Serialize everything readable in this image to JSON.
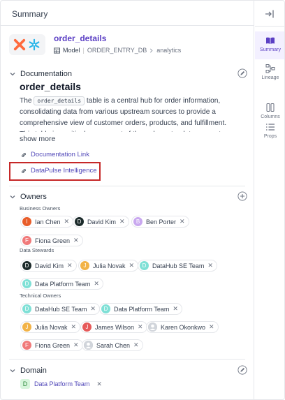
{
  "header": {
    "title": "Summary"
  },
  "entity": {
    "name": "order_details",
    "type": "Model",
    "db": "ORDER_ENTRY_DB",
    "schema": "analytics"
  },
  "documentation": {
    "section_title": "Documentation",
    "title": "order_details",
    "body_pre": "The ",
    "body_code": "order_details",
    "body_post": " table is a central hub for order information, consolidating data from various upstream sources to provide a comprehensive view of customer orders, products, and fulfillment. This table is a critical component of the order entry data ecosystem",
    "show_more": "show more",
    "links": [
      "Documentation Link",
      "DataPulse Intelligence"
    ]
  },
  "owners": {
    "section_title": "Owners",
    "groups": [
      {
        "label": "Business Owners",
        "owners": [
          {
            "initial": "I",
            "name": "Ian Chen",
            "color": "#e85d2a"
          },
          {
            "initial": "D",
            "name": "David Kim",
            "color": "#1c2b2b"
          },
          {
            "initial": "B",
            "name": "Ben Porter",
            "color": "#c9a8ef"
          },
          {
            "initial": "F",
            "name": "Fiona Green",
            "color": "#f07a7a"
          }
        ]
      },
      {
        "label": "Data Stewards",
        "owners": [
          {
            "initial": "D",
            "name": "David Kim",
            "color": "#1c2b2b"
          },
          {
            "initial": "J",
            "name": "Julia Novak",
            "color": "#f2b347"
          },
          {
            "initial": "D",
            "name": "DataHub SE Team",
            "color": "#7fe0d6"
          },
          {
            "initial": "D",
            "name": "Data Platform Team",
            "color": "#7fe0d6"
          }
        ]
      },
      {
        "label": "Technical Owners",
        "owners": [
          {
            "initial": "D",
            "name": "DataHub SE Team",
            "color": "#7fe0d6"
          },
          {
            "initial": "D",
            "name": "Data Platform Team",
            "color": "#7fe0d6"
          },
          {
            "initial": "J",
            "name": "Julia Novak",
            "color": "#f2b347"
          },
          {
            "initial": "J",
            "name": "James Wilson",
            "color": "#e65a5a"
          },
          {
            "initial": "",
            "name": "Karen Okonkwo",
            "color": "#bdbdbd"
          },
          {
            "initial": "F",
            "name": "Fiona Green",
            "color": "#f07a7a"
          },
          {
            "initial": "",
            "name": "Sarah Chen",
            "color": "#bdbdbd"
          }
        ]
      }
    ]
  },
  "domain": {
    "section_title": "Domain",
    "badge": "D",
    "name": "Data Platform Team"
  },
  "rail": {
    "items": [
      "Summary",
      "Lineage",
      "Columns",
      "Props"
    ]
  },
  "colors": {
    "accent": "#5b3fc4",
    "link": "#4f46b8",
    "highlight": "#c62828"
  }
}
